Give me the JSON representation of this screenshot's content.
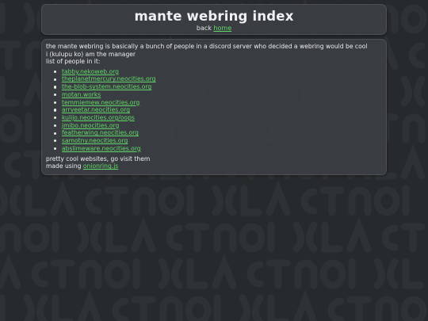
{
  "header": {
    "title": "mante webring index",
    "back_prefix": "back",
    "home_link": "home"
  },
  "main": {
    "intro_line1": "the mante webring is basically a bunch of people in a discord server who decided a webring would be cool",
    "intro_line2": "i (kulupu ko) am the manager",
    "list_label": "list of people in it:",
    "sites": [
      "tabby.nekoweb.org",
      "theplanetmercury.neocities.org",
      "the-blob-system.neocities.org",
      "motan.works",
      "temmiemew.neocities.org",
      "arrveetar.neocities.org",
      "kulijo.neocities.org/oops",
      "jmibo.neocities.org",
      "featherwing.neocities.org",
      "samotny.neocities.org",
      "abslimeware.neocities.org"
    ],
    "closing_line": "pretty cool websites, go visit them",
    "made_using_prefix": "made using",
    "made_using_link": "onionring.js"
  },
  "colors": {
    "background": "#272a2c",
    "card": "#3c4044",
    "link": "#62d86a",
    "text": "#eceef0"
  }
}
